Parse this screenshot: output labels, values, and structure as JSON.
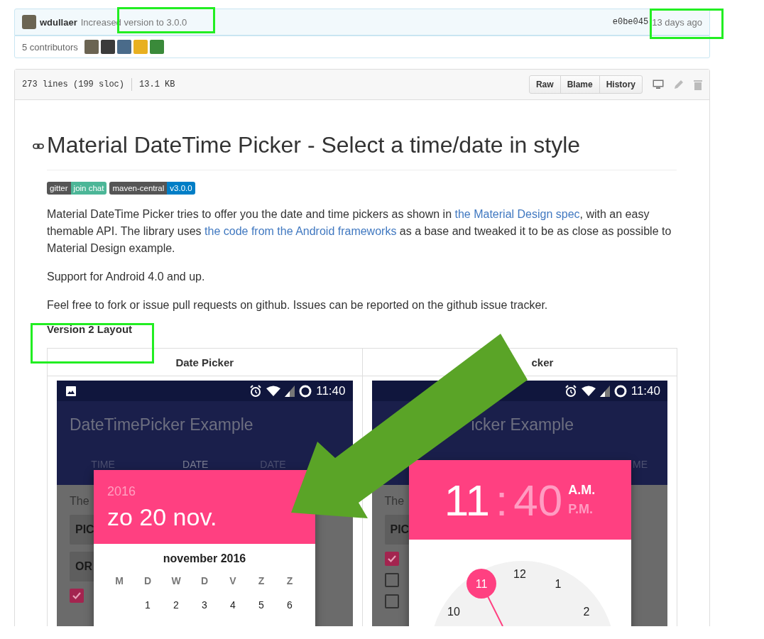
{
  "commit": {
    "author": "wdullaer",
    "message": "Increased version to 3.0.0",
    "sha": "e0be045",
    "age": "13 days ago"
  },
  "contributors": {
    "label": "5 contributors",
    "avatars": [
      {
        "kind": "photo"
      },
      {
        "kind": "photo"
      },
      {
        "kind": "photo"
      },
      {
        "kind": "photo"
      },
      {
        "kind": "photo"
      }
    ]
  },
  "file": {
    "lines": "273 lines (199 sloc)",
    "size": "13.1 KB",
    "buttons": [
      "Raw",
      "Blame",
      "History"
    ]
  },
  "readme": {
    "title": "Material DateTime Picker - Select a time/date in style",
    "badges": [
      {
        "label": "gitter",
        "value": "join chat",
        "color": "#4cb697"
      },
      {
        "label": "maven-central",
        "value": "v3.0.0",
        "color": "#007ec6"
      }
    ],
    "paragraphs": [
      [
        {
          "text": "Material DateTime Picker tries to offer you the date and time pickers as shown in ",
          "kind": "text"
        },
        {
          "text": "the Material Design spec",
          "kind": "link"
        },
        {
          "text": ", with an easy themable API. The library uses ",
          "kind": "text"
        },
        {
          "text": "the code from the Android frameworks",
          "kind": "link"
        },
        {
          "text": " as a base and tweaked it to be as close as possible to Material Design example.",
          "kind": "text"
        }
      ],
      [
        {
          "text": "Support for Android 4.0 and up.",
          "kind": "text"
        }
      ],
      [
        {
          "text": "Feel free to fork or issue pull requests on github. Issues can be reported on the github issue tracker.",
          "kind": "text"
        }
      ]
    ],
    "subheading": "Version 2 Layout",
    "table": {
      "columns": [
        "Date Picker",
        "cker"
      ],
      "screens": [
        {
          "kind": "date",
          "status_time": "11:40",
          "app_title": "DateTimePicker Example",
          "tabs": [
            {
              "label": "TIME",
              "selected": false
            },
            {
              "label": "DATE",
              "selected": true
            },
            {
              "label": "DATE",
              "selected": false
            }
          ],
          "body_text": "The",
          "buttons": [
            "PIC",
            "OR"
          ],
          "checkboxes": [
            {
              "checked": true
            }
          ],
          "dialog": {
            "year": "2016",
            "date": "zo 20 nov.",
            "month": "november 2016",
            "weekdays": [
              "M",
              "D",
              "W",
              "D",
              "V",
              "Z",
              "Z"
            ],
            "days": [
              "1",
              "2",
              "3",
              "4",
              "5",
              "6"
            ]
          }
        },
        {
          "kind": "time",
          "status_time": "11:40",
          "app_title": "icker Example",
          "tabs": [
            {
              "label": "ME",
              "selected": false
            }
          ],
          "body_text": "The",
          "buttons": [
            "PIC"
          ],
          "checkboxes": [
            {
              "checked": true
            },
            {
              "checked": false
            },
            {
              "checked": false
            }
          ],
          "dialog": {
            "fields": [
              {
                "text": "11",
                "selected": true
              },
              {
                "text": "40",
                "selected": false
              }
            ],
            "separator": ":",
            "periods": [
              {
                "label": "A.M.",
                "selected": true
              },
              {
                "label": "P.M.",
                "selected": false
              }
            ],
            "clock_numbers": [
              {
                "label": "12",
                "selected": false
              },
              {
                "label": "1",
                "selected": false
              },
              {
                "label": "2",
                "selected": false
              },
              {
                "label": "10",
                "selected": false
              },
              {
                "label": "11",
                "selected": true
              }
            ]
          }
        }
      ]
    }
  }
}
